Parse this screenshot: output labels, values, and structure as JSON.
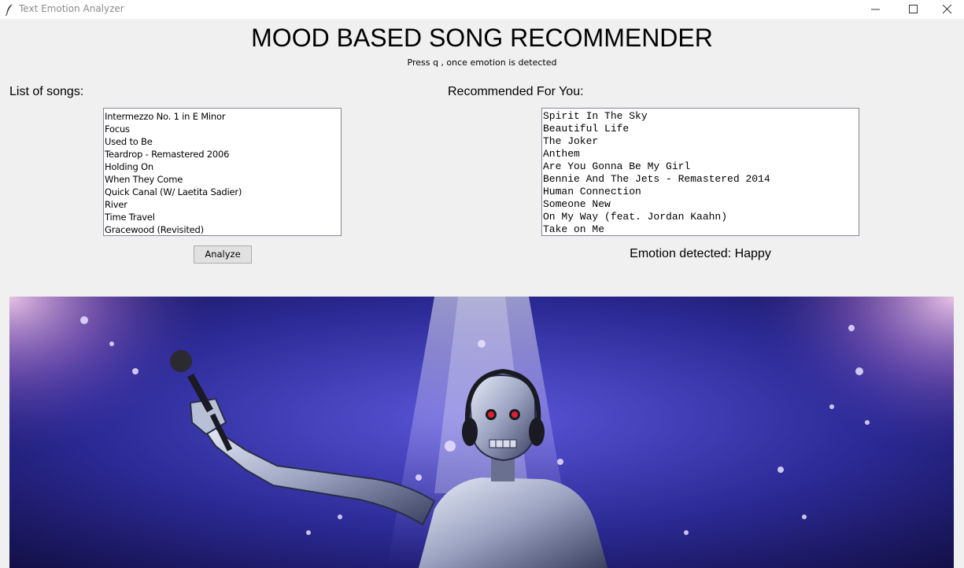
{
  "window": {
    "title": "Text Emotion Analyzer",
    "icon": "feather-icon",
    "controls": [
      "minimize-icon",
      "maximize-icon",
      "close-icon"
    ]
  },
  "header": {
    "title": "MOOD BASED SONG RECOMMENDER",
    "subtitle": "Press q , once emotion is detected"
  },
  "songs": {
    "label": "List of songs:",
    "items": [
      "Intermezzo No. 1 in E Minor",
      "Focus",
      "Used to Be",
      "Teardrop - Remastered 2006",
      "Holding On",
      "When They Come",
      "Quick Canal (W/ Laetita Sadier)",
      "River",
      "Time Travel",
      "Gracewood (Revisited)"
    ]
  },
  "recommended": {
    "label": "Recommended For You:",
    "items": [
      "Spirit In The Sky",
      "Beautiful Life",
      "The Joker",
      "Anthem",
      "Are You Gonna Be My Girl",
      "Bennie And The Jets - Remastered 2014",
      "Human Connection",
      "Someone New",
      "On My Way (feat. Jordan Kaahn)",
      "Take on Me"
    ]
  },
  "actions": {
    "analyze_label": "Analyze"
  },
  "status": {
    "emotion_text": "Emotion detected: Happy"
  },
  "banner": {
    "subject": "robot singer with microphone on stage under spotlights",
    "colors": {
      "background": "#2a2a8a",
      "spotlight": "#c8b8ff",
      "robot": "#b8c0d8",
      "eyes": "#e02030"
    }
  }
}
